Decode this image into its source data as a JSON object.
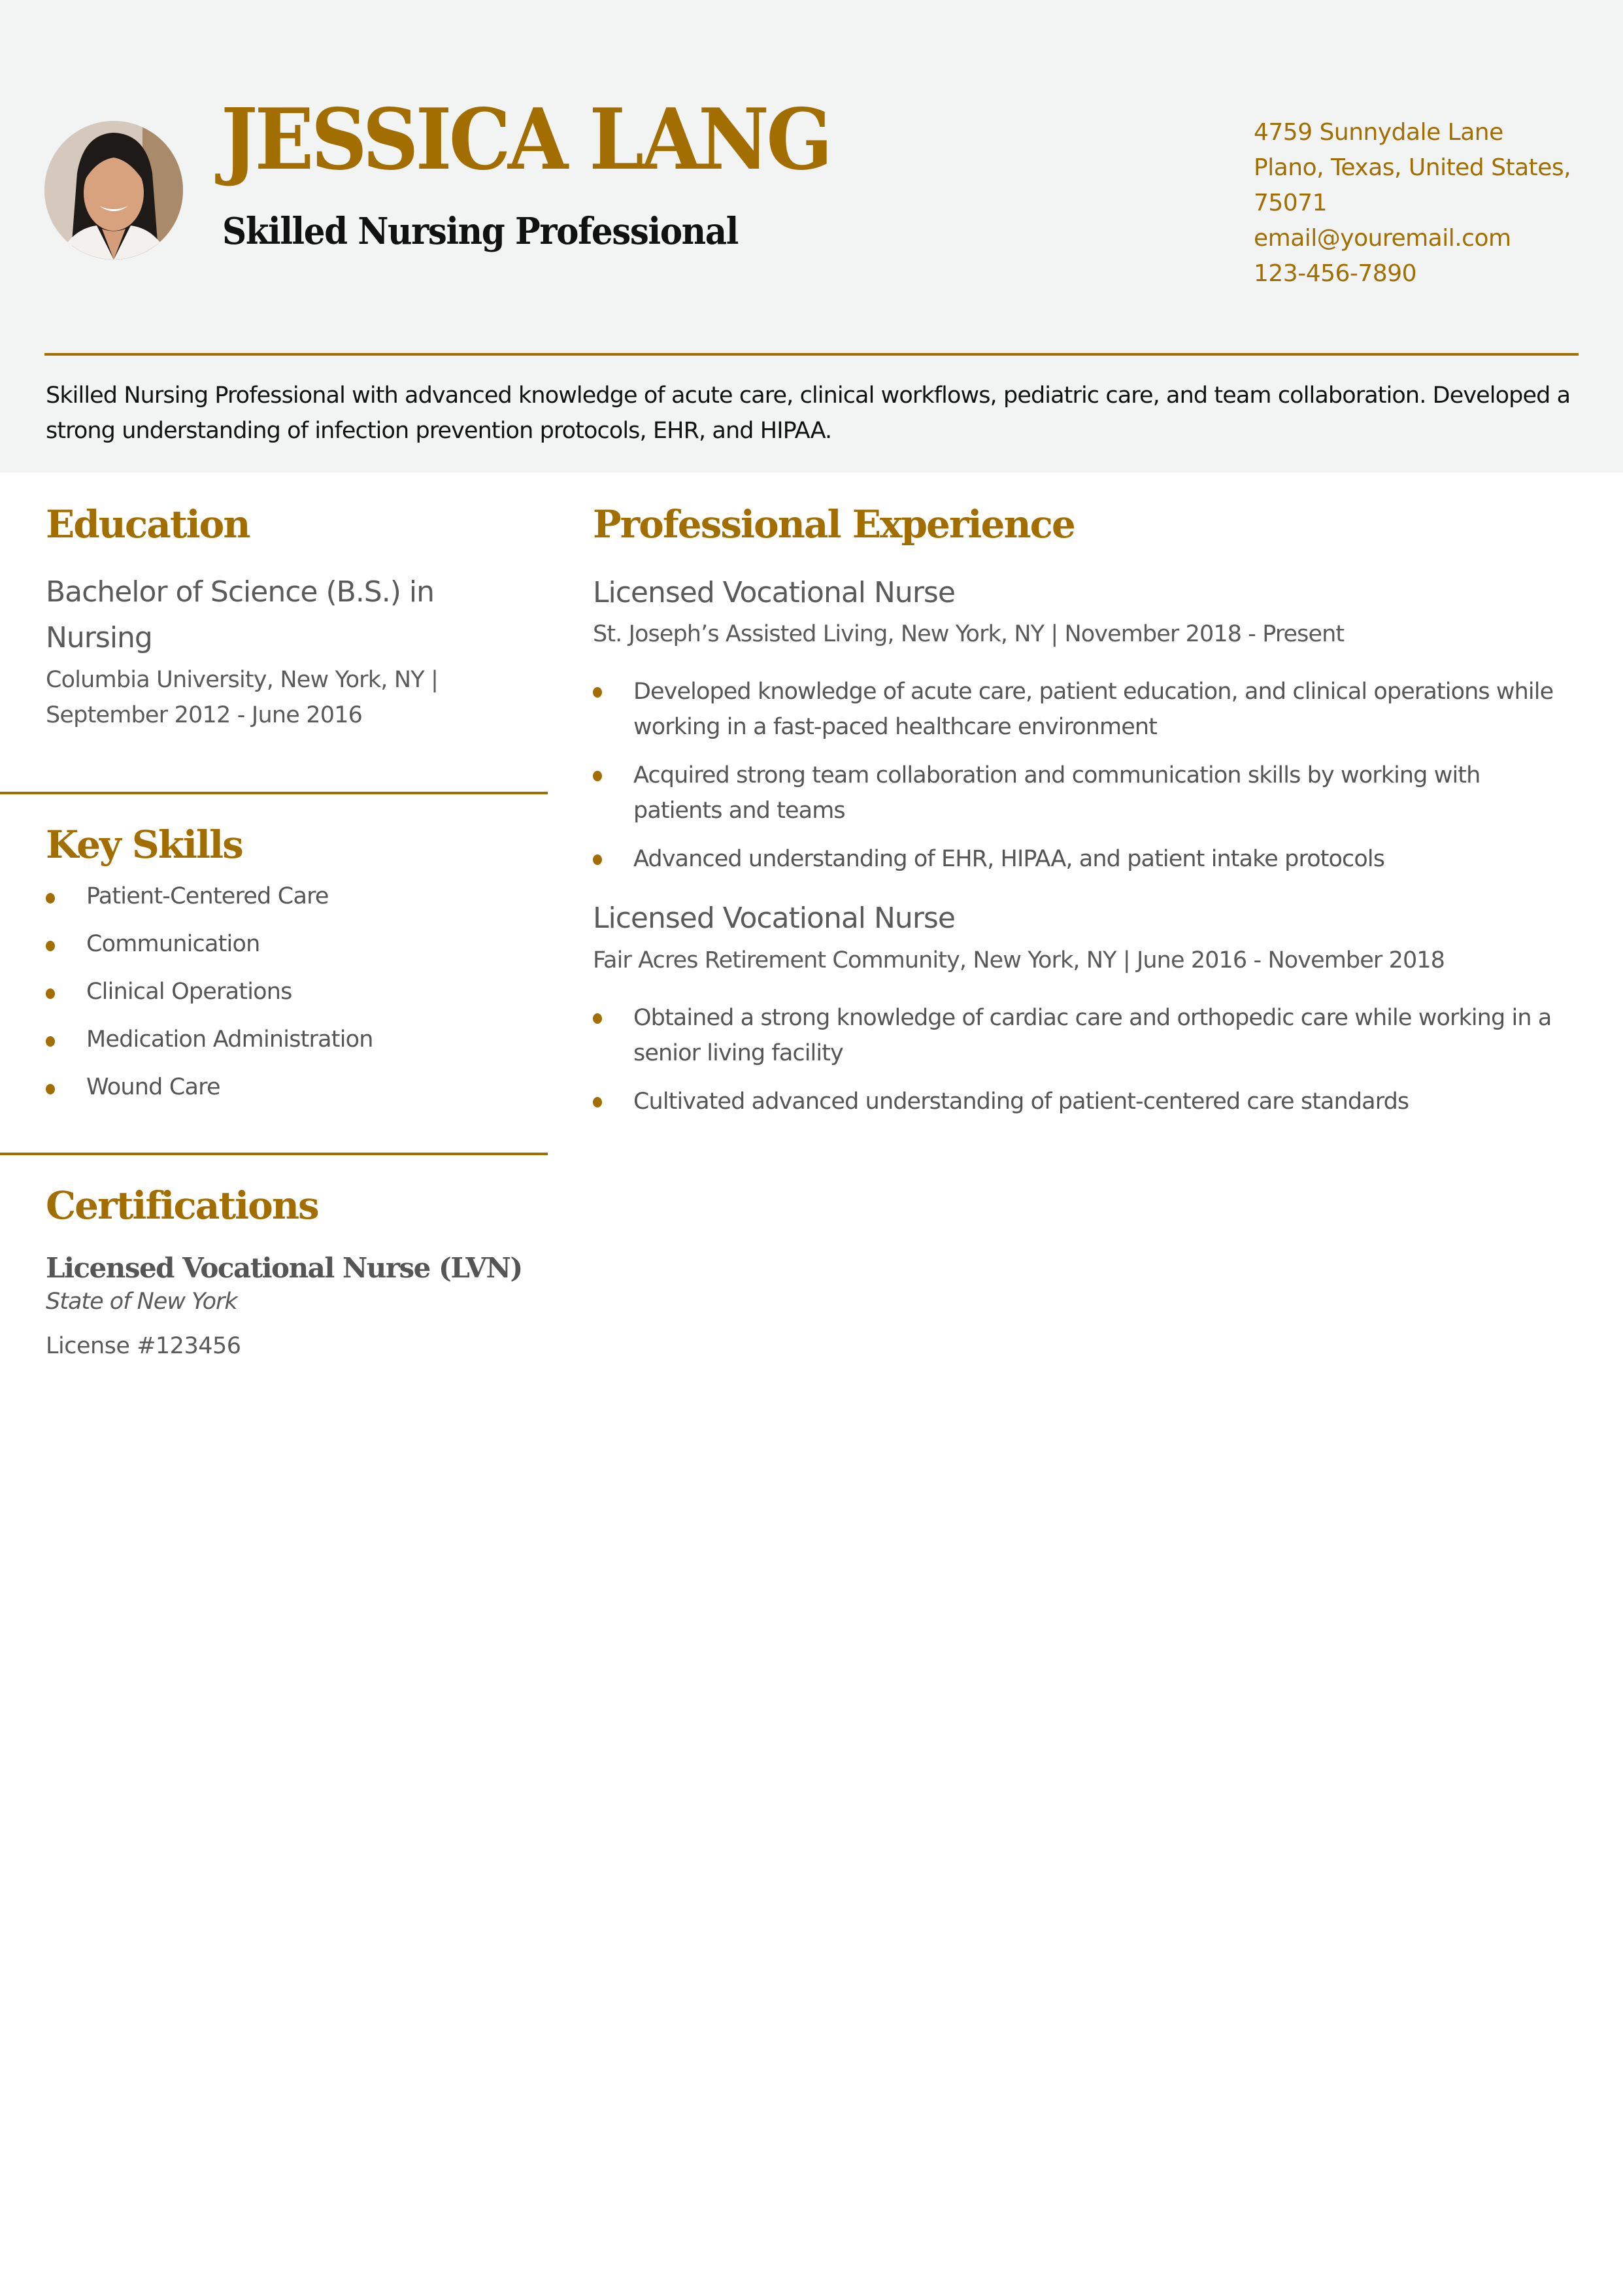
{
  "header": {
    "name": "JESSICA LANG",
    "headline": "Skilled Nursing Professional",
    "photo_alt": "Profile photo",
    "contact": {
      "address_line1": "4759 Sunnydale Lane",
      "address_line2": "Plano, Texas, United States,",
      "address_line3": "75071",
      "email": "email@youremail.com",
      "phone": "123-456-7890"
    },
    "summary": "Skilled Nursing Professional with advanced knowledge of acute care, clinical workflows, pediatric care, and team collaboration. Developed a strong understanding of infection prevention protocols, EHR, and HIPAA."
  },
  "colors": {
    "accent": "#a36e00",
    "header_background": "#f2f3f3",
    "body_text": "#555555"
  },
  "education": {
    "title": "Education",
    "degree": "Bachelor of Science (B.S.) in Nursing",
    "school_line": "Columbia University, New York, NY |",
    "dates": "September 2012 - June 2016"
  },
  "skills": {
    "title": "Key Skills",
    "items": [
      "Patient-Centered Care",
      "Communication",
      "Clinical Operations",
      "Medication Administration",
      "Wound Care"
    ]
  },
  "certifications": {
    "title": "Certifications",
    "items": [
      {
        "name": "Licensed Vocational Nurse (LVN)",
        "issuer": "State of New York",
        "license": "License #123456"
      }
    ]
  },
  "experience": {
    "title": "Professional Experience",
    "jobs": [
      {
        "title": "Licensed Vocational Nurse",
        "meta": "St. Joseph’s Assisted Living, New York, NY | November 2018 - Present",
        "bullets": [
          "Developed knowledge of acute care, patient education, and clinical operations while working in a fast-paced healthcare environment",
          "Acquired strong team collaboration and communication skills by working with patients and teams",
          "Advanced understanding of EHR, HIPAA, and patient intake protocols"
        ]
      },
      {
        "title": "Licensed Vocational Nurse",
        "meta": "Fair Acres Retirement Community, New York, NY | June 2016 - November 2018",
        "bullets": [
          "Obtained a strong knowledge of cardiac care and orthopedic care while working in a senior living facility",
          "Cultivated advanced understanding of patient-centered care standards"
        ]
      }
    ]
  }
}
